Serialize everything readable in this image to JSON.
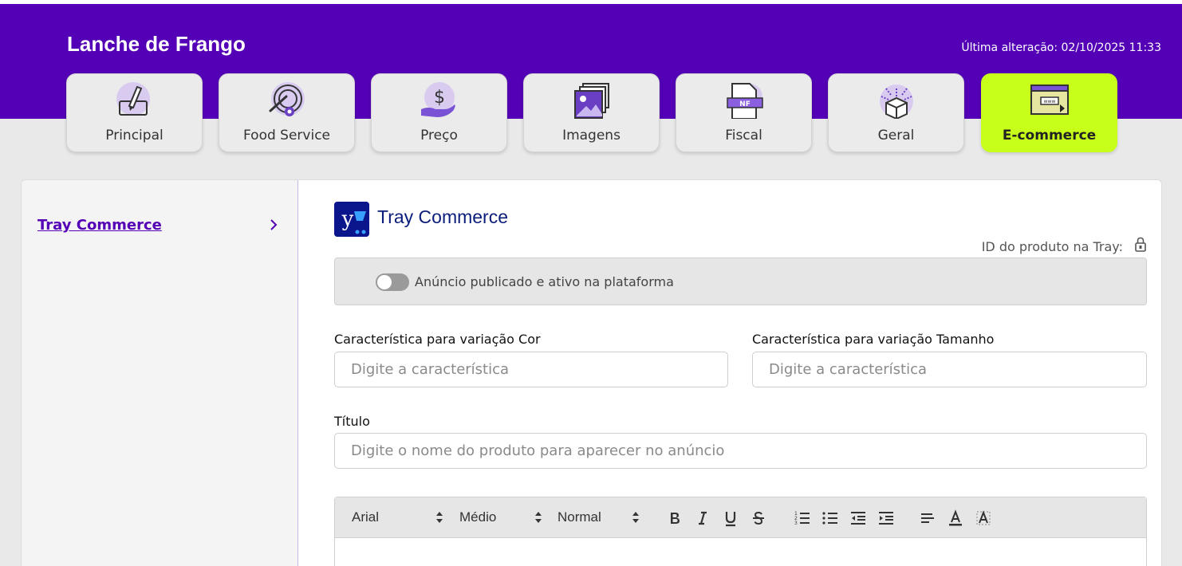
{
  "header": {
    "title": "Lanche de Frango",
    "last_change": "Última alteração: 02/10/2025 11:33"
  },
  "tabs": [
    {
      "label": "Principal",
      "icon": "pencil-edit-icon"
    },
    {
      "label": "Food Service",
      "icon": "plate-cutlery-gear-icon"
    },
    {
      "label": "Preço",
      "icon": "dollar-hand-icon"
    },
    {
      "label": "Imagens",
      "icon": "images-icon"
    },
    {
      "label": "Fiscal",
      "icon": "nf-document-icon"
    },
    {
      "label": "Geral",
      "icon": "box-sparkle-icon"
    },
    {
      "label": "E-commerce",
      "icon": "web-browser-icon",
      "active": true
    }
  ],
  "sidebar": {
    "items": [
      {
        "label": "Tray Commerce"
      }
    ]
  },
  "main": {
    "brand_title": "Tray Commerce",
    "id_label": "ID do produto na Tray:",
    "toggle_label": "Anúncio publicado e ativo na plataforma",
    "fields": {
      "cor_label": "Característica para variação Cor",
      "cor_placeholder": "Digite a característica",
      "tamanho_label": "Característica para variação Tamanho",
      "tamanho_placeholder": "Digite a característica",
      "titulo_label": "Título",
      "titulo_placeholder": "Digite o nome do produto para aparecer no anúncio"
    },
    "editor": {
      "font": "Arial",
      "size": "Médio",
      "style": "Normal"
    }
  },
  "colors": {
    "header": "#5300b6",
    "active_tab": "#c8ff1a",
    "brand": "#0b168c"
  }
}
